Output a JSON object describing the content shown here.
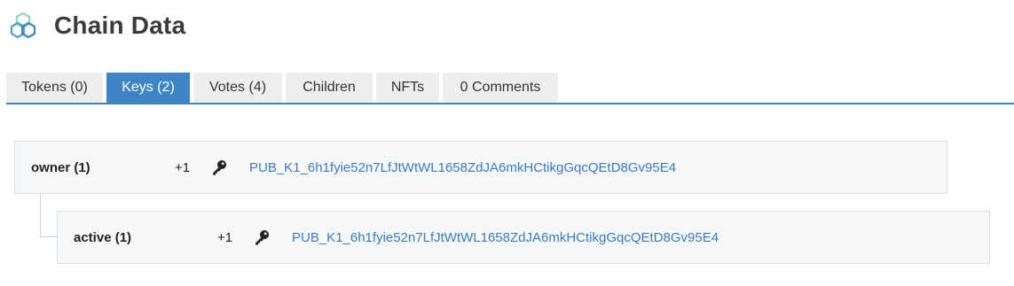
{
  "header": {
    "title": "Chain Data",
    "logo_icon": "hexagon-network-icon",
    "accent_color": "#3a83c5"
  },
  "tabs": [
    {
      "label": "Tokens (0)",
      "active": false
    },
    {
      "label": "Keys (2)",
      "active": true
    },
    {
      "label": "Votes (4)",
      "active": false
    },
    {
      "label": "Children",
      "active": false
    },
    {
      "label": "NFTs",
      "active": false
    },
    {
      "label": "0 Comments",
      "active": false
    }
  ],
  "permissions": [
    {
      "name": "owner (1)",
      "weight": "+1",
      "icon": "key-icon",
      "key": "PUB_K1_6h1fyie52n7LfJtWtWL1658ZdJA6mkHCtikgGqcQEtD8Gv95E4"
    },
    {
      "name": "active (1)",
      "weight": "+1",
      "icon": "key-icon",
      "key": "PUB_K1_6h1fyie52n7LfJtWtWL1658ZdJA6mkHCtikgGqcQEtD8Gv95E4"
    }
  ]
}
